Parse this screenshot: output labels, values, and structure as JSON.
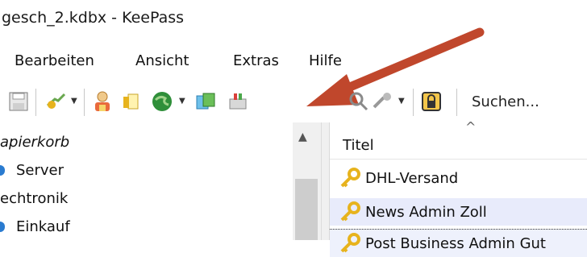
{
  "window": {
    "title": "gesch_2.kdbx - KeePass"
  },
  "menu": {
    "items": [
      "Bearbeiten",
      "Ansicht",
      "Extras",
      "Hilfe"
    ]
  },
  "toolbar": {
    "search_label": "Suchen...",
    "icons": [
      "save-icon",
      "open-database-icon",
      "add-entry-icon",
      "edit-entry-icon",
      "sync-icon",
      "copy-icon",
      "plugin-icon",
      "find-icon",
      "autotype-icon",
      "lock-icon"
    ]
  },
  "tree": {
    "items": [
      {
        "label": "apierkorb",
        "italic": true
      },
      {
        "label": "Server",
        "group": true
      },
      {
        "label": "echtronik",
        "group": false
      },
      {
        "label": "Einkauf",
        "group": true
      }
    ]
  },
  "list": {
    "header": "Titel",
    "entries": [
      {
        "title": "DHL-Versand"
      },
      {
        "title": "News Admin  Zoll"
      },
      {
        "title": "Post Business Admin  Gut"
      }
    ]
  },
  "colors": {
    "accent_arrow": "#c0472c",
    "selection": "#e8ebfb",
    "key_gold": "#e7b31d"
  }
}
